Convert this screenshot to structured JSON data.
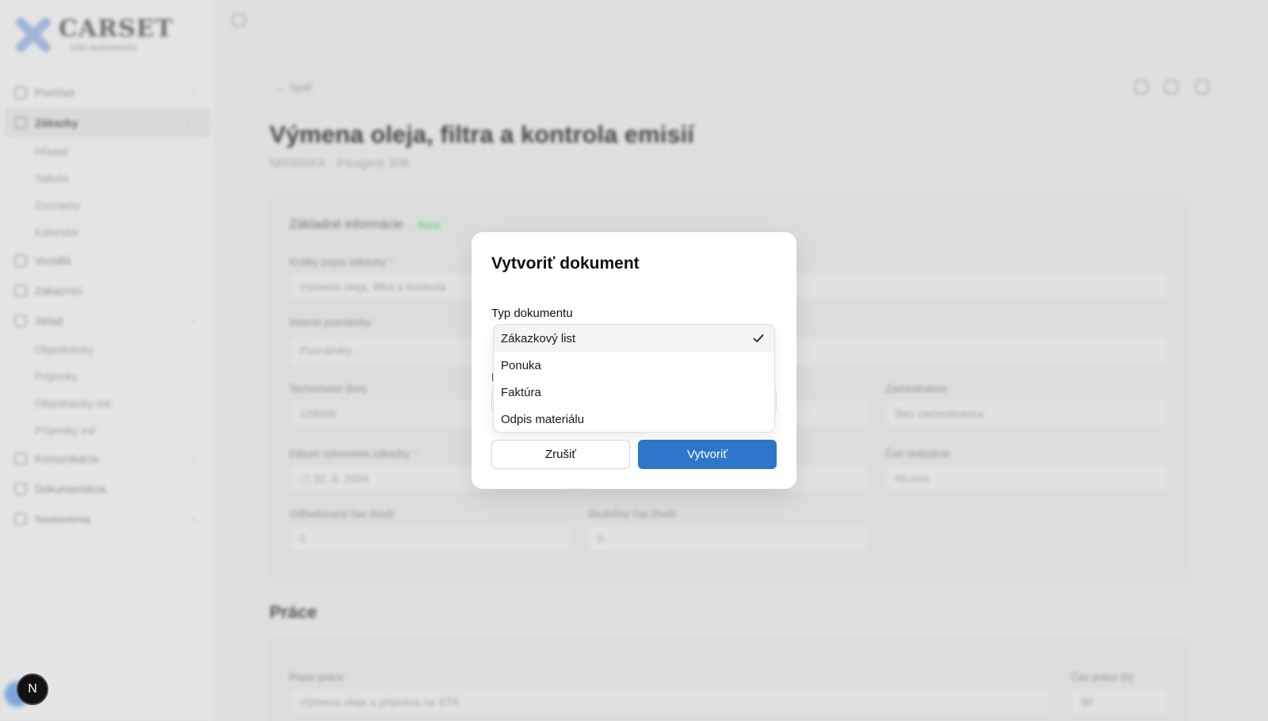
{
  "app": {
    "logo": {
      "name": "CARSET",
      "sub": "odd autoservis"
    },
    "sidebar": {
      "items": [
        {
          "label": "Prehľad",
          "icon": "dashboard-icon",
          "chevron": true
        },
        {
          "label": "Zákazky",
          "icon": "clipboard-icon",
          "chevron": true,
          "active": true,
          "children": [
            "Hľadať",
            "Tabuľa",
            "Zoznamy",
            "Kalendár"
          ]
        },
        {
          "label": "Vozidlá",
          "icon": "car-icon"
        },
        {
          "label": "Zákazníci",
          "icon": "users-icon"
        },
        {
          "label": "Sklad",
          "icon": "warehouse-icon",
          "chevron": true,
          "children": [
            "Objednávky",
            "Príjemky",
            "Objednávky iné",
            "Príjemky iné"
          ]
        },
        {
          "label": "Komunikácia",
          "icon": "chat-icon",
          "chevron": true
        },
        {
          "label": "Dokumentácia",
          "icon": "document-icon"
        },
        {
          "label": "Nastavenia",
          "icon": "settings-icon",
          "chevron": true
        }
      ]
    },
    "header": {
      "back_label": "← Späť"
    },
    "page": {
      "title": "Výmena oleja, filtra a kontrola emisií",
      "subtitle": "NR000XX · Peugeot 308"
    },
    "card": {
      "heading": "Základné informácie",
      "badge": "Nová",
      "fields": {
        "short_desc_label": "Krátky popis zákazky",
        "short_desc_value": "Výmena oleja, filtra a kontrola",
        "notes_label": "Interné poznámky",
        "notes_placeholder": "Poznámky...",
        "odometer_label": "Tachometer (km)",
        "odometer_value": "128000",
        "employee_label": "Zamestnanec",
        "employee_placeholder": "Bez zamestnanca",
        "date_label": "Dátum vytvorenia zákazky",
        "date_value": "20. 6. 2024",
        "time_label": "Čas realizácie",
        "time_placeholder": "hh:mm",
        "est_time_label": "Odhadovaný čas (hod)",
        "est_time_value": "0",
        "real_time_label": "Skutočný čas (hod)",
        "real_time_value": "0"
      }
    },
    "work_section": {
      "title": "Práce",
      "desc_label": "Popis práce",
      "desc_value": "Výmena oleja a príprava na STK",
      "qty_label": "Čas práce (h)",
      "qty_value": "80"
    }
  },
  "modal": {
    "title": "Vytvoriť dokument",
    "type_label": "Typ dokumentu",
    "second_label_initial": "D",
    "options": [
      {
        "label": "Zákazkový list",
        "selected": true
      },
      {
        "label": "Ponuka",
        "selected": false
      },
      {
        "label": "Faktúra",
        "selected": false
      },
      {
        "label": "Odpis materiálu",
        "selected": false
      }
    ],
    "cancel_label": "Zrušiť",
    "create_label": "Vytvoriť"
  },
  "dev_badge": {
    "label": "N"
  },
  "colors": {
    "primary": "#2e76cb",
    "badge_green": "#6dbb87"
  }
}
